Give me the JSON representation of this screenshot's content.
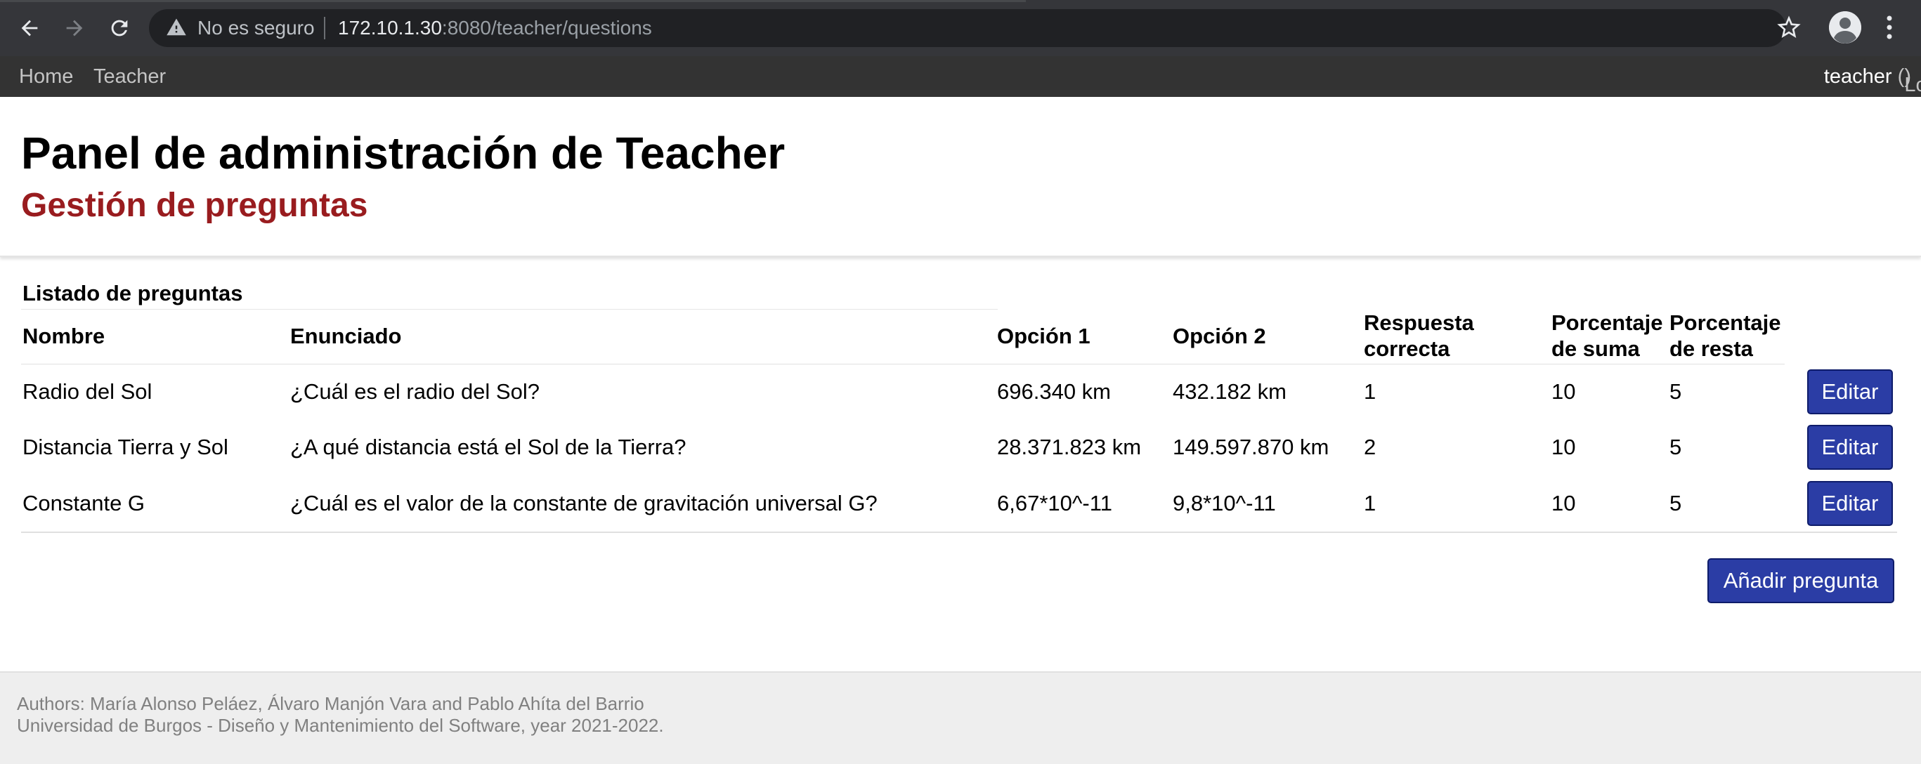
{
  "browser": {
    "security_label": "No es seguro",
    "url_host": "172.10.1.30",
    "url_path": ":8080/teacher/questions",
    "icons": [
      "back-arrow-icon",
      "forward-arrow-icon",
      "reload-icon",
      "warning-icon",
      "star-icon",
      "profile-icon",
      "more-vert-icon"
    ]
  },
  "navbar": {
    "home": "Home",
    "teacher": "Teacher",
    "username": "teacher",
    "open_paren": "(",
    "logout": "Log out",
    "close_paren": ")"
  },
  "header": {
    "title": "Panel de administración de Teacher",
    "subtitle": "Gestión de preguntas",
    "subtitle_color": "#991c1f"
  },
  "table": {
    "caption": "Listado de preguntas",
    "headers": {
      "nombre": "Nombre",
      "enunciado": "Enunciado",
      "opcion1": "Opción 1",
      "opcion2": "Opción 2",
      "respuesta_1": "Respuesta",
      "respuesta_2": "correcta",
      "suma_1": "Porcentaje",
      "suma_2": "de suma",
      "resta_1": "Porcentaje",
      "resta_2": "de resta"
    },
    "rows": [
      {
        "nombre": "Radio del Sol",
        "enunciado": "¿Cuál es el radio del Sol?",
        "opcion1": "696.340 km",
        "opcion2": "432.182 km",
        "respuesta": "1",
        "suma": "10",
        "resta": "5",
        "edit_label": "Editar"
      },
      {
        "nombre": "Distancia Tierra y Sol",
        "enunciado": "¿A qué distancia está el Sol de la Tierra?",
        "opcion1": "28.371.823 km",
        "opcion2": "149.597.870 km",
        "respuesta": "2",
        "suma": "10",
        "resta": "5",
        "edit_label": "Editar"
      },
      {
        "nombre": "Constante G",
        "enunciado": "¿Cuál es el valor de la constante de gravitación universal G?",
        "opcion1": "6,67*10^-11",
        "opcion2": "9,8*10^-11",
        "respuesta": "1",
        "suma": "10",
        "resta": "5",
        "edit_label": "Editar"
      }
    ],
    "add_label": "Añadir pregunta",
    "button_color": "#2b3da5"
  },
  "footer": {
    "authors": "Authors: María Alonso Peláez, Álvaro Manjón Vara and Pablo Ahíta del Barrio",
    "university": "Universidad de Burgos - Diseño y Mantenimiento del Software, year 2021-2022."
  }
}
